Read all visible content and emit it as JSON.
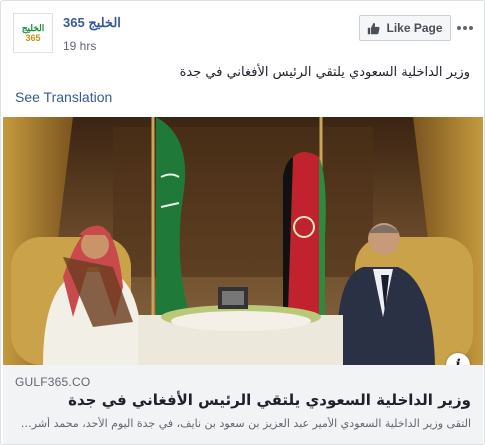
{
  "post": {
    "page_name": "الخليج 365",
    "timestamp": "19 hrs",
    "text": "وزير الداخلية السعودي يلتقي الرئيس الأفغاني في جدة",
    "see_translation": "See Translation",
    "like_page_label": "Like Page",
    "more_icon": "more-dots-icon",
    "avatar": {
      "logo_text": "الخليج",
      "logo_number": "365"
    }
  },
  "photo": {
    "description_icon": "info-icon",
    "info_label": "i"
  },
  "link": {
    "domain": "GULF365.CO",
    "title": "وزير الداخلية السعودي يلتقي الرئيس الأفغاني في جدة",
    "description": "التقى وزير الداخلية السعودي الأمير عبد العزيز بن سعود بن نايف، في جدة اليوم الأحد، محمد أشرف غني .."
  },
  "colors": {
    "link_blue": "#385898",
    "page_name": "#365899",
    "text": "#1d2129",
    "muted": "#606770",
    "link_bg": "#f2f3f5"
  }
}
